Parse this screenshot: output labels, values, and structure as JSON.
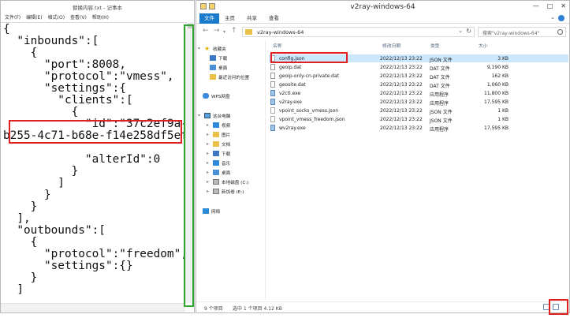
{
  "notepad": {
    "title": "替换内容.txt - 记事本",
    "menu": [
      "文件(F)",
      "编辑(E)",
      "格式(O)",
      "查看(V)",
      "帮助(H)"
    ],
    "code": "{\n  \"inbounds\":[\n    {\n      \"port\":8008,\n      \"protocol\":\"vmess\",\n      \"settings\":{\n        \"clients\":[\n          {\n            \"id\":\"37c2ef9a-\nb255-4c71-b68e-f14e258df5ef\"\n\n            \"alterId\":0\n          }\n        ]\n      }\n    }\n  ],\n  \"outbounds\":[\n    {\n      \"protocol\":\"freedom\",\n      \"settings\":{}\n    }\n  ]"
  },
  "explorer": {
    "title": "v2ray-windows-64",
    "ribbon_tabs": [
      "文件",
      "主页",
      "共享",
      "查看"
    ],
    "address": "v2ray-windows-64",
    "search_placeholder": "搜索\"v2ray-windows-64\"",
    "sidebar": [
      {
        "label": "收藏夹",
        "icon": "star-icon"
      },
      {
        "label": "下载",
        "icon": "download-folder-icon"
      },
      {
        "label": "桌面",
        "icon": "desktop-icon"
      },
      {
        "label": "最近访问的位置",
        "icon": "recent-icon"
      },
      {
        "label": "WPS网盘",
        "icon": "cloud-icon"
      },
      {
        "label": "这台电脑",
        "icon": "computer-icon"
      },
      {
        "label": "视频",
        "icon": "video-folder-icon"
      },
      {
        "label": "图片",
        "icon": "pictures-folder-icon"
      },
      {
        "label": "文档",
        "icon": "documents-folder-icon"
      },
      {
        "label": "下载",
        "icon": "download-folder-icon"
      },
      {
        "label": "音乐",
        "icon": "music-folder-icon"
      },
      {
        "label": "桌面",
        "icon": "desktop-icon"
      },
      {
        "label": "本地磁盘 (C:)",
        "icon": "drive-icon"
      },
      {
        "label": "新加卷 (E:)",
        "icon": "drive-icon"
      },
      {
        "label": "网络",
        "icon": "network-icon"
      }
    ],
    "columns": [
      "名称",
      "修改日期",
      "类型",
      "大小"
    ],
    "files": [
      {
        "name": "config.json",
        "date": "2022/12/13 23:22",
        "type": "JSON 文件",
        "size": "3 KB",
        "kind": "json"
      },
      {
        "name": "geoip.dat",
        "date": "2022/12/13 23:22",
        "type": "DAT 文件",
        "size": "9,190 KB",
        "kind": "dat"
      },
      {
        "name": "geoip-only-cn-private.dat",
        "date": "2022/12/13 23:22",
        "type": "DAT 文件",
        "size": "162 KB",
        "kind": "dat"
      },
      {
        "name": "geosite.dat",
        "date": "2022/12/13 23:22",
        "type": "DAT 文件",
        "size": "1,060 KB",
        "kind": "dat"
      },
      {
        "name": "v2ctl.exe",
        "date": "2022/12/13 23:22",
        "type": "应用程序",
        "size": "11,800 KB",
        "kind": "exe"
      },
      {
        "name": "v2ray.exe",
        "date": "2022/12/13 23:22",
        "type": "应用程序",
        "size": "17,595 KB",
        "kind": "exe"
      },
      {
        "name": "vpoint_socks_vmess.json",
        "date": "2022/12/13 23:22",
        "type": "JSON 文件",
        "size": "1 KB",
        "kind": "json"
      },
      {
        "name": "vpoint_vmess_freedom.json",
        "date": "2022/12/13 23:22",
        "type": "JSON 文件",
        "size": "1 KB",
        "kind": "json"
      },
      {
        "name": "wv2ray.exe",
        "date": "2022/12/13 23:22",
        "type": "应用程序",
        "size": "17,595 KB",
        "kind": "exe"
      }
    ],
    "status": {
      "count": "9 个项目",
      "selected": "选中 1 个项目  4.12 KB"
    }
  },
  "colors": {
    "highlight_red": "#e02020",
    "highlight_green": "#2ea52e",
    "selection": "#cce8ff",
    "ribbon_file": "#1979ca"
  }
}
